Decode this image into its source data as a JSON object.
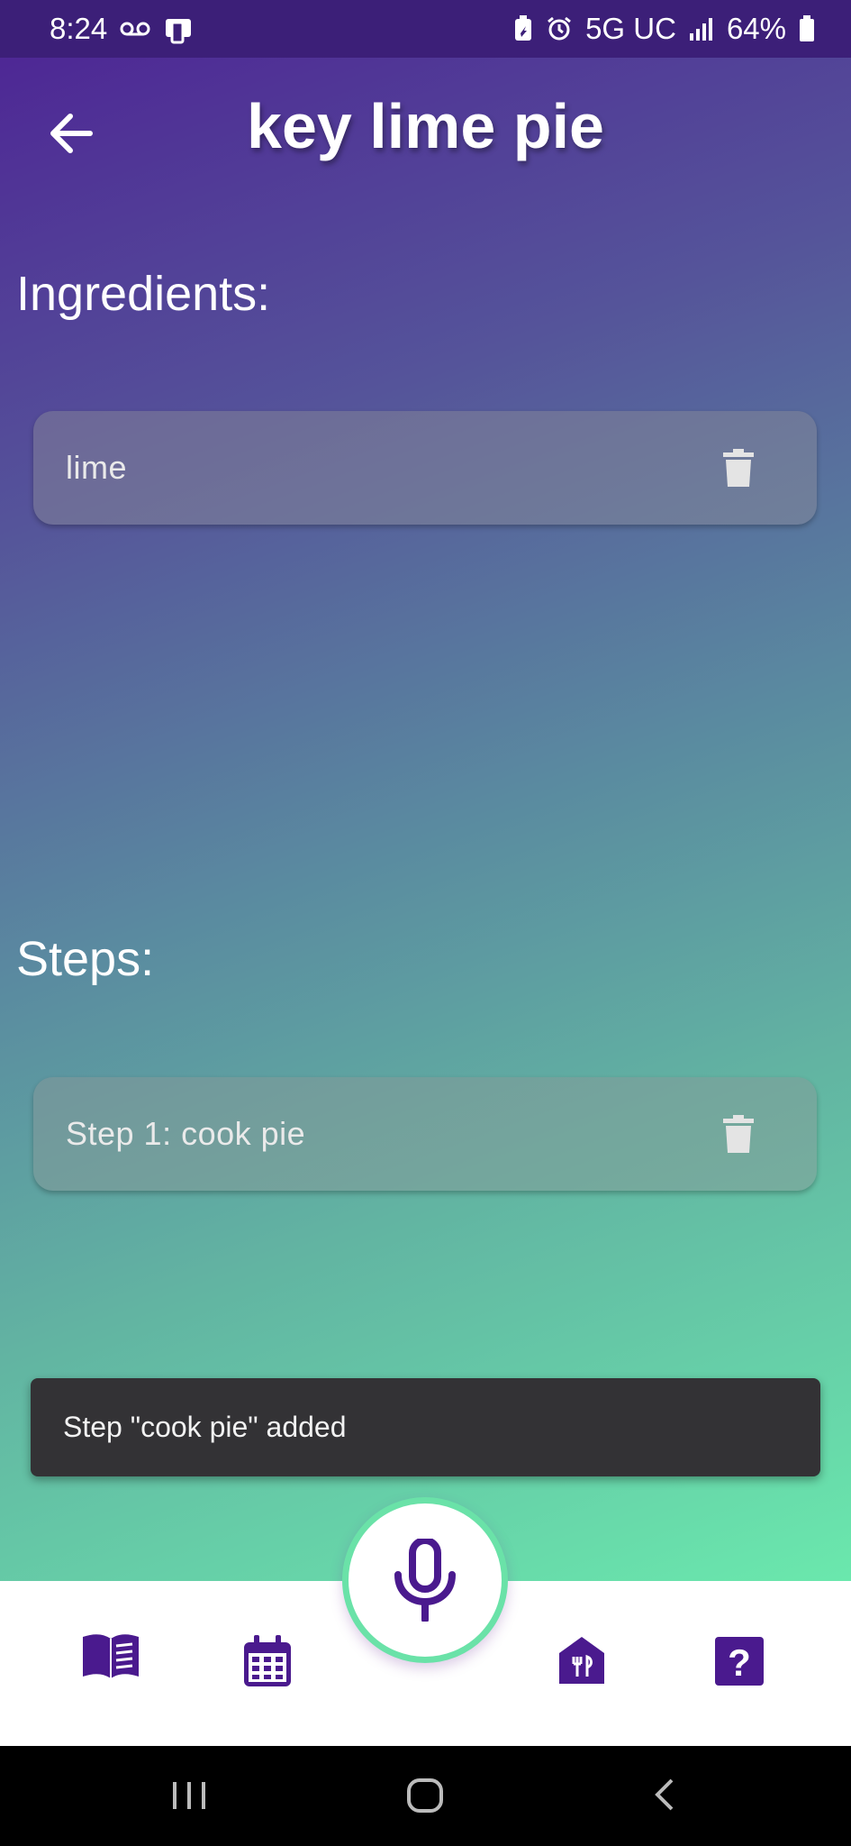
{
  "status_bar": {
    "time": "8:24",
    "network": "5G UC",
    "battery": "64%"
  },
  "header": {
    "title": "key lime pie",
    "back_icon": "arrow-left-icon"
  },
  "ingredients": {
    "label": "Ingredients:",
    "items": [
      {
        "text": "lime"
      }
    ]
  },
  "steps": {
    "label": "Steps:",
    "items": [
      {
        "text": "Step 1: cook pie"
      }
    ]
  },
  "snackbar": {
    "message": "Step \"cook pie\" added"
  },
  "bottom_nav": {
    "items": [
      "book-icon",
      "calendar-icon",
      "mic-icon",
      "restaurant-icon",
      "help-icon"
    ],
    "accent": "#4a1a8e",
    "mic_ring": "#6ae2a8"
  },
  "colors": {
    "gradient_top": "#4d2294",
    "gradient_bottom": "#6ae8ad"
  }
}
